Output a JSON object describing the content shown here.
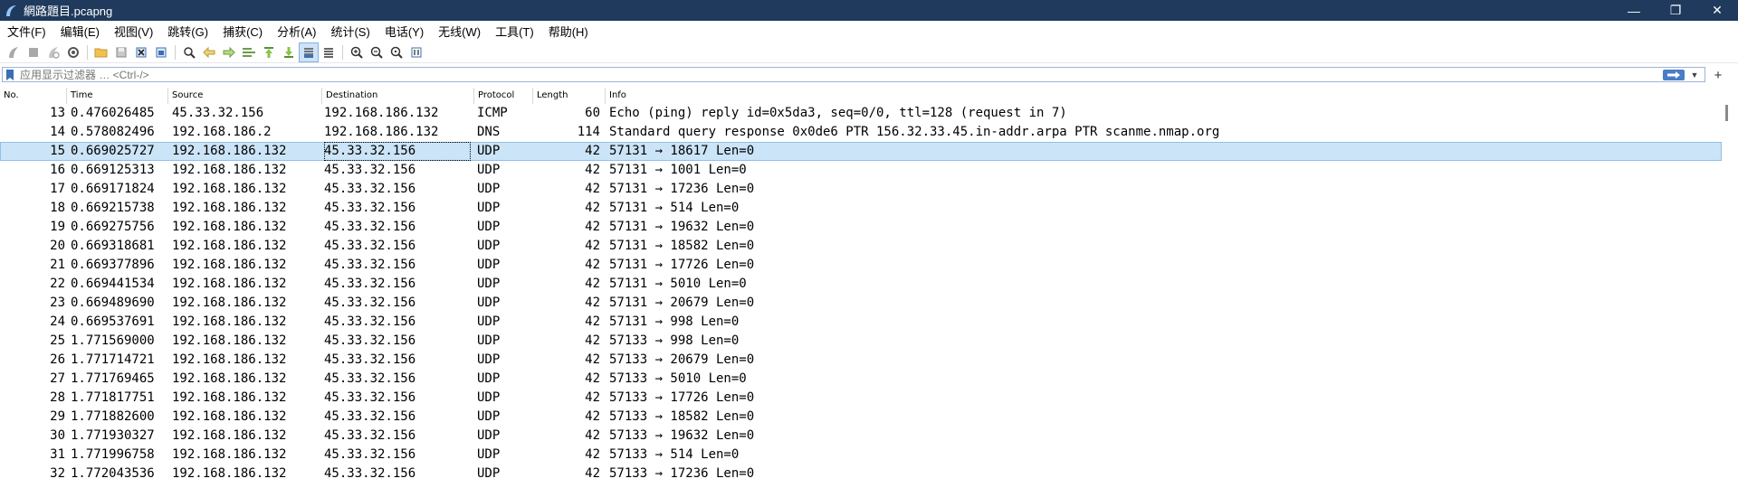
{
  "window": {
    "title": "網路題目.pcapng",
    "controls": {
      "minimize": "—",
      "maximize": "❐",
      "close": "✕"
    }
  },
  "menu": [
    "文件(F)",
    "编辑(E)",
    "视图(V)",
    "跳转(G)",
    "捕获(C)",
    "分析(A)",
    "统计(S)",
    "电话(Y)",
    "无线(W)",
    "工具(T)",
    "帮助(H)"
  ],
  "toolbar": {
    "icons": [
      "shark-fin-start-icon",
      "stop-square-icon",
      "restart-fin-icon",
      "options-gear-icon",
      "open-folder-icon",
      "save-file-icon",
      "close-file-icon",
      "reload-file-icon",
      "find-magnifier-icon",
      "go-back-arrow-icon",
      "go-forward-arrow-icon",
      "go-to-packet-icon",
      "go-first-packet-icon",
      "go-last-packet-icon",
      "autoscroll-icon",
      "colorize-lines-icon",
      "zoom-in-icon",
      "zoom-out-icon",
      "zoom-normal-icon",
      "resize-columns-icon"
    ],
    "accent": "#3a6fb5"
  },
  "filter": {
    "placeholder": "应用显示过滤器 … <Ctrl-/>",
    "value": "",
    "add_label": "+"
  },
  "packet_list": {
    "columns": [
      "No.",
      "Time",
      "Source",
      "Destination",
      "Protocol",
      "Length",
      "Info"
    ],
    "selected_row_color": "#cce4f7",
    "rows": [
      {
        "no": "13",
        "time": "0.476026485",
        "src": "45.33.32.156",
        "dst": "192.168.186.132",
        "proto": "ICMP",
        "len": "60",
        "info": "Echo (ping) reply    id=0x5da3, seq=0/0, ttl=128 (request in 7)"
      },
      {
        "no": "14",
        "time": "0.578082496",
        "src": "192.168.186.2",
        "dst": "192.168.186.132",
        "proto": "DNS",
        "len": "114",
        "info": "Standard query response 0x0de6 PTR 156.32.33.45.in-addr.arpa PTR scanme.nmap.org"
      },
      {
        "no": "15",
        "time": "0.669025727",
        "src": "192.168.186.132",
        "dst": "45.33.32.156",
        "proto": "UDP",
        "len": "42",
        "info": "57131 → 18617 Len=0",
        "selected": true
      },
      {
        "no": "16",
        "time": "0.669125313",
        "src": "192.168.186.132",
        "dst": "45.33.32.156",
        "proto": "UDP",
        "len": "42",
        "info": "57131 → 1001 Len=0"
      },
      {
        "no": "17",
        "time": "0.669171824",
        "src": "192.168.186.132",
        "dst": "45.33.32.156",
        "proto": "UDP",
        "len": "42",
        "info": "57131 → 17236 Len=0"
      },
      {
        "no": "18",
        "time": "0.669215738",
        "src": "192.168.186.132",
        "dst": "45.33.32.156",
        "proto": "UDP",
        "len": "42",
        "info": "57131 → 514 Len=0"
      },
      {
        "no": "19",
        "time": "0.669275756",
        "src": "192.168.186.132",
        "dst": "45.33.32.156",
        "proto": "UDP",
        "len": "42",
        "info": "57131 → 19632 Len=0"
      },
      {
        "no": "20",
        "time": "0.669318681",
        "src": "192.168.186.132",
        "dst": "45.33.32.156",
        "proto": "UDP",
        "len": "42",
        "info": "57131 → 18582 Len=0"
      },
      {
        "no": "21",
        "time": "0.669377896",
        "src": "192.168.186.132",
        "dst": "45.33.32.156",
        "proto": "UDP",
        "len": "42",
        "info": "57131 → 17726 Len=0"
      },
      {
        "no": "22",
        "time": "0.669441534",
        "src": "192.168.186.132",
        "dst": "45.33.32.156",
        "proto": "UDP",
        "len": "42",
        "info": "57131 → 5010 Len=0"
      },
      {
        "no": "23",
        "time": "0.669489690",
        "src": "192.168.186.132",
        "dst": "45.33.32.156",
        "proto": "UDP",
        "len": "42",
        "info": "57131 → 20679 Len=0"
      },
      {
        "no": "24",
        "time": "0.669537691",
        "src": "192.168.186.132",
        "dst": "45.33.32.156",
        "proto": "UDP",
        "len": "42",
        "info": "57131 → 998 Len=0"
      },
      {
        "no": "25",
        "time": "1.771569000",
        "src": "192.168.186.132",
        "dst": "45.33.32.156",
        "proto": "UDP",
        "len": "42",
        "info": "57133 → 998 Len=0"
      },
      {
        "no": "26",
        "time": "1.771714721",
        "src": "192.168.186.132",
        "dst": "45.33.32.156",
        "proto": "UDP",
        "len": "42",
        "info": "57133 → 20679 Len=0"
      },
      {
        "no": "27",
        "time": "1.771769465",
        "src": "192.168.186.132",
        "dst": "45.33.32.156",
        "proto": "UDP",
        "len": "42",
        "info": "57133 → 5010 Len=0"
      },
      {
        "no": "28",
        "time": "1.771817751",
        "src": "192.168.186.132",
        "dst": "45.33.32.156",
        "proto": "UDP",
        "len": "42",
        "info": "57133 → 17726 Len=0"
      },
      {
        "no": "29",
        "time": "1.771882600",
        "src": "192.168.186.132",
        "dst": "45.33.32.156",
        "proto": "UDP",
        "len": "42",
        "info": "57133 → 18582 Len=0"
      },
      {
        "no": "30",
        "time": "1.771930327",
        "src": "192.168.186.132",
        "dst": "45.33.32.156",
        "proto": "UDP",
        "len": "42",
        "info": "57133 → 19632 Len=0"
      },
      {
        "no": "31",
        "time": "1.771996758",
        "src": "192.168.186.132",
        "dst": "45.33.32.156",
        "proto": "UDP",
        "len": "42",
        "info": "57133 → 514 Len=0"
      },
      {
        "no": "32",
        "time": "1.772043536",
        "src": "192.168.186.132",
        "dst": "45.33.32.156",
        "proto": "UDP",
        "len": "42",
        "info": "57133 → 17236 Len=0"
      }
    ]
  }
}
